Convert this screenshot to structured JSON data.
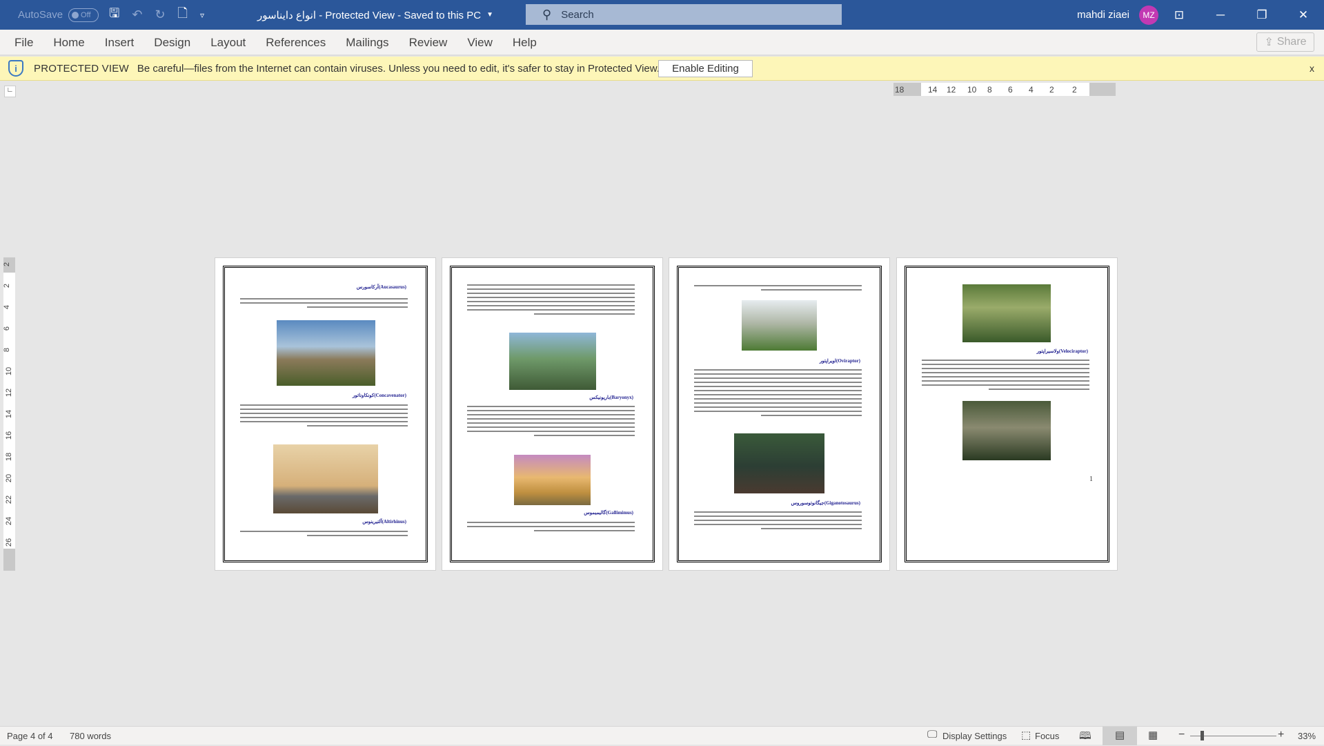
{
  "titlebar": {
    "autosave_label": "AutoSave",
    "autosave_state": "Off",
    "doc_title": "انواع دایناسور  -  Protected View  -  Saved to this PC",
    "search_placeholder": "Search",
    "user_name": "mahdi ziaei",
    "user_initials": "MZ",
    "bg_color": "#2b579a"
  },
  "ribbon": {
    "tabs": [
      "File",
      "Home",
      "Insert",
      "Design",
      "Layout",
      "References",
      "Mailings",
      "Review",
      "View",
      "Help"
    ],
    "share_label": "Share"
  },
  "protected_view": {
    "label": "PROTECTED VIEW",
    "message": "Be careful—files from the Internet can contain viruses. Unless you need to edit, it's safer to stay in Protected View.",
    "enable_button": "Enable Editing",
    "close": "x"
  },
  "ruler": {
    "h_ticks": [
      "18",
      "14",
      "12",
      "10",
      "8",
      "6",
      "4",
      "2",
      "2"
    ],
    "v_ticks": [
      "2",
      "2",
      "4",
      "6",
      "8",
      "10",
      "12",
      "14",
      "16",
      "18",
      "20",
      "22",
      "24",
      "26"
    ]
  },
  "pages": [
    {
      "headings": [
        "آرکاسورس(Aucasaurus)",
        "کونکاوناتور(Concavenator)",
        "آلتیرینوس(Altirhinus)"
      ]
    },
    {
      "headings": [
        "باریونیکس(Baryonyx)",
        "گالیمیموس(Gallimimus)"
      ]
    },
    {
      "headings": [
        "اویراپتور(Oviraptor)",
        "جیگانوتوسوروس(Giganotosaurus)"
      ]
    },
    {
      "headings": [
        "ولاسیراپتور(Velociraptor)"
      ],
      "page_number": "1"
    }
  ],
  "status": {
    "page": "Page 4 of 4",
    "words": "780 words",
    "display_settings": "Display Settings",
    "focus": "Focus",
    "zoom": "33%",
    "zoom_percent": 33
  }
}
